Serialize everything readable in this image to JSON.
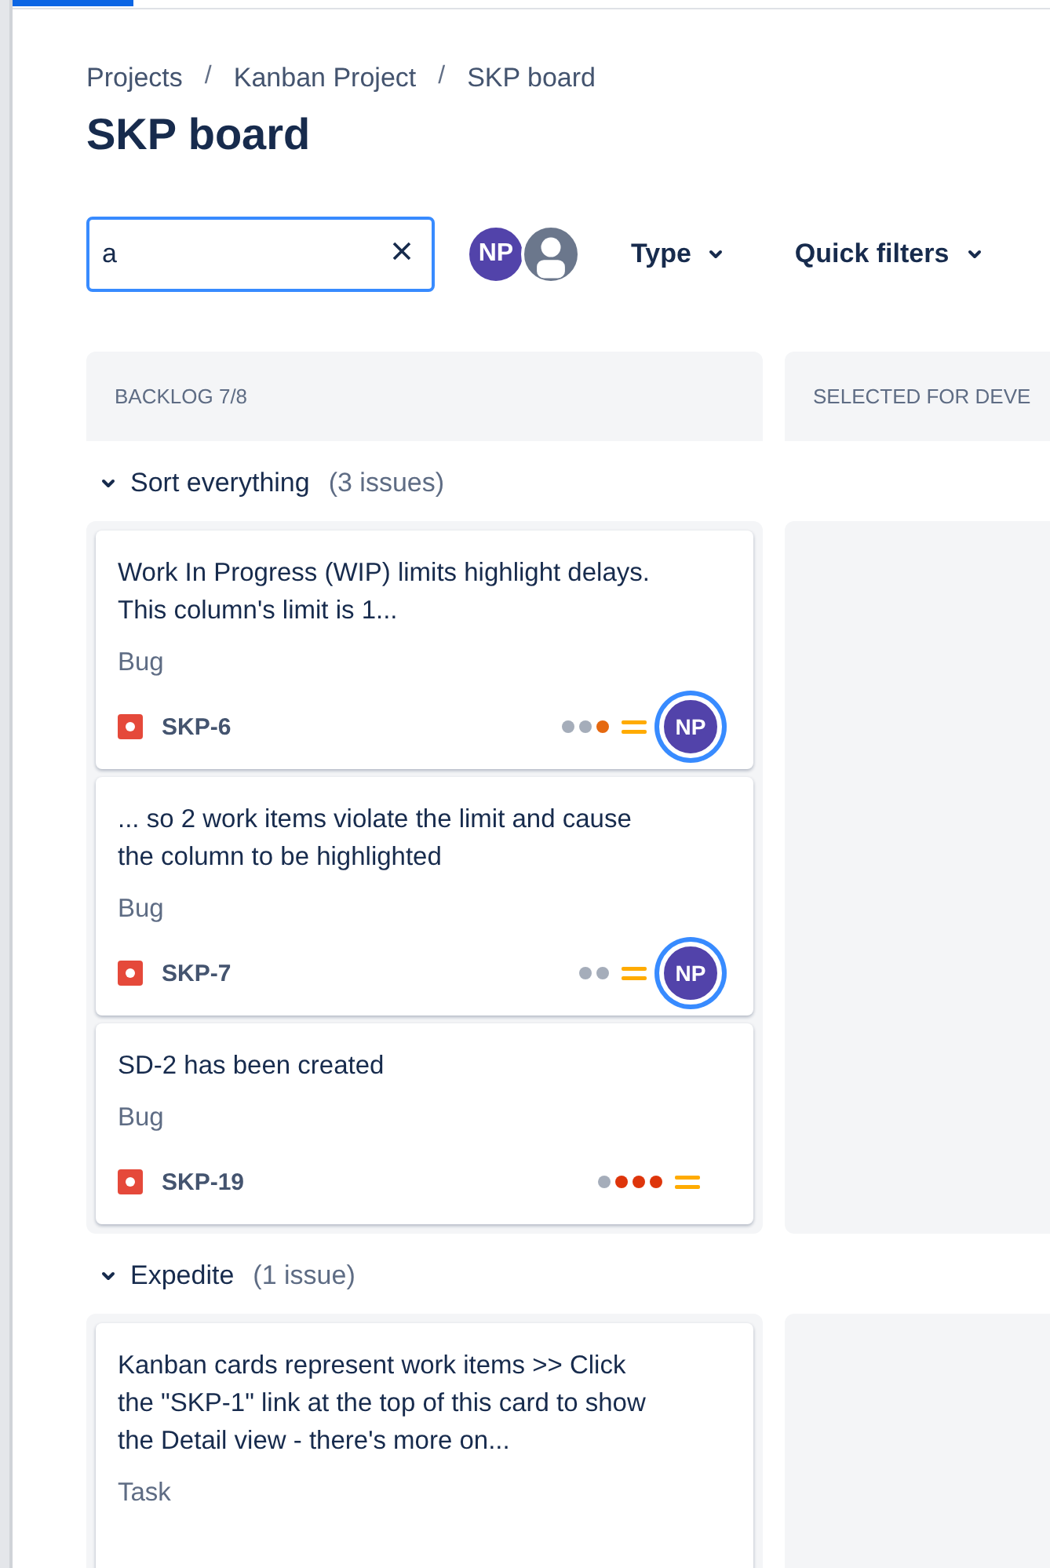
{
  "loading_bar": {
    "level": 0.117
  },
  "breadcrumbs": [
    {
      "kind": "link",
      "text": "Projects"
    },
    {
      "kind": "separator",
      "text": "/"
    },
    {
      "kind": "link",
      "text": "Kanban Project"
    },
    {
      "kind": "separator",
      "text": "/"
    },
    {
      "kind": "link",
      "text": "SKP board"
    }
  ],
  "title": "SKP board",
  "search": {
    "value": "a"
  },
  "avatars": [
    {
      "kind": "initials",
      "initials": "NP",
      "color": "#5243aa"
    },
    {
      "kind": "silhouette",
      "color": "#6b778c"
    }
  ],
  "filters": [
    {
      "label": "Type"
    },
    {
      "label": "Quick filters"
    }
  ],
  "columns": [
    {
      "title": "BACKLOG 7/8"
    },
    {
      "title": "SELECTED FOR DEVE"
    }
  ],
  "swimlanes": [
    {
      "name": "Sort everything",
      "count": "(3 issues)",
      "expanded": true,
      "cards": [
        {
          "title": "Work In Progress (WIP) limits highlight delays. This column's limit is 1...",
          "type": "Bug",
          "key": "SKP-6",
          "dots": [
            {
              "color": "#a5adba"
            },
            {
              "color": "#a5adba"
            },
            {
              "color": "#e56910"
            }
          ],
          "assignee": "NP"
        },
        {
          "title": "... so 2 work items violate the limit and cause the column to be highlighted",
          "type": "Bug",
          "key": "SKP-7",
          "dots": [
            {
              "color": "#a5adba"
            },
            {
              "color": "#a5adba"
            }
          ],
          "assignee": "NP"
        },
        {
          "title": "SD-2 has been created",
          "type": "Bug",
          "key": "SKP-19",
          "dots": [
            {
              "color": "#a5adba"
            },
            {
              "color": "#de350b"
            },
            {
              "color": "#de350b"
            },
            {
              "color": "#de350b"
            }
          ]
        }
      ]
    },
    {
      "name": "Expedite",
      "count": "(1 issue)",
      "expanded": true,
      "cards": [
        {
          "title": "Kanban cards represent work items >> Click the \"SKP-1\" link at the top of this card to show the Detail view - there's more on...",
          "type": "Task"
        }
      ]
    }
  ]
}
